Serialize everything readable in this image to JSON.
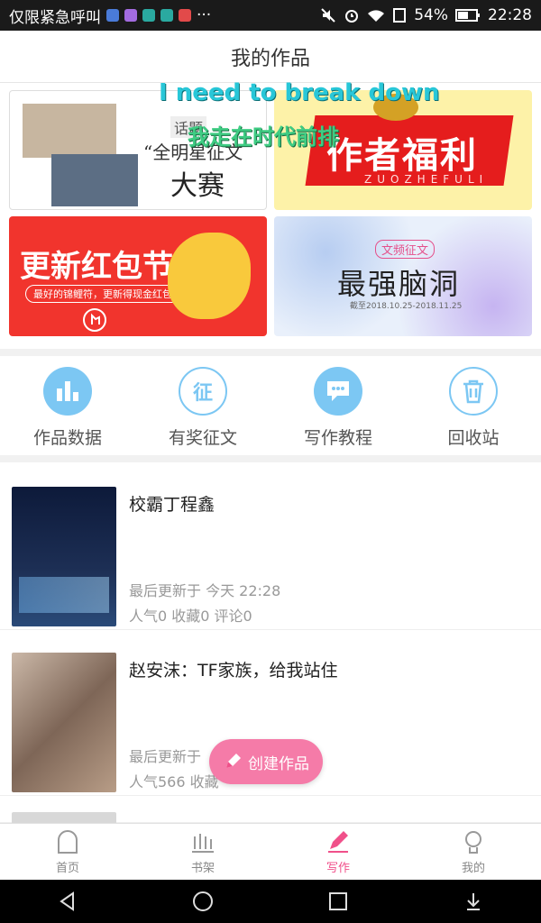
{
  "status": {
    "carrier": "仅限紧急呼叫",
    "battery": "54%",
    "time": "22:28",
    "indicator": "···"
  },
  "header": {
    "title": "我的作品"
  },
  "overlays": {
    "line1": "I need to break down",
    "line2": "我走在时代前排"
  },
  "banners": [
    {
      "title": "“全明星征文",
      "subtitle": "大赛",
      "tag": "话题"
    },
    {
      "title": "作者福利",
      "subtitle": "ZUOZHEFULI"
    },
    {
      "title": "更新红包节",
      "subtitle": "最好的锦鲤符，更新得现金红包"
    },
    {
      "title": "最强脑洞",
      "tag": "文频征文",
      "subtitle": "截至2018.10.25-2018.11.25"
    }
  ],
  "quick_actions": [
    {
      "label": "作品数据",
      "icon": "bar-chart-icon"
    },
    {
      "label": "有奖征文",
      "icon": "zheng-icon"
    },
    {
      "label": "写作教程",
      "icon": "chat-bubble-icon"
    },
    {
      "label": "回收站",
      "icon": "trash-icon"
    }
  ],
  "works": [
    {
      "title": "校霸丁程鑫",
      "updated": "最后更新于 今天 22:28",
      "stats": "人气0 收藏0 评论0"
    },
    {
      "title": "赵安沫：TF家族，给我站住",
      "updated": "最后更新于",
      "stats": "人气566 收藏"
    }
  ],
  "fab": {
    "label": "创建作品"
  },
  "tabs": [
    {
      "label": "首页",
      "icon": "home-icon"
    },
    {
      "label": "书架",
      "icon": "bookshelf-icon"
    },
    {
      "label": "写作",
      "icon": "pen-icon"
    },
    {
      "label": "我的",
      "icon": "profile-icon"
    }
  ],
  "colors": {
    "accent": "#f0508a",
    "quick_icon": "#7cc7f3",
    "fab": "#f57ba8"
  }
}
